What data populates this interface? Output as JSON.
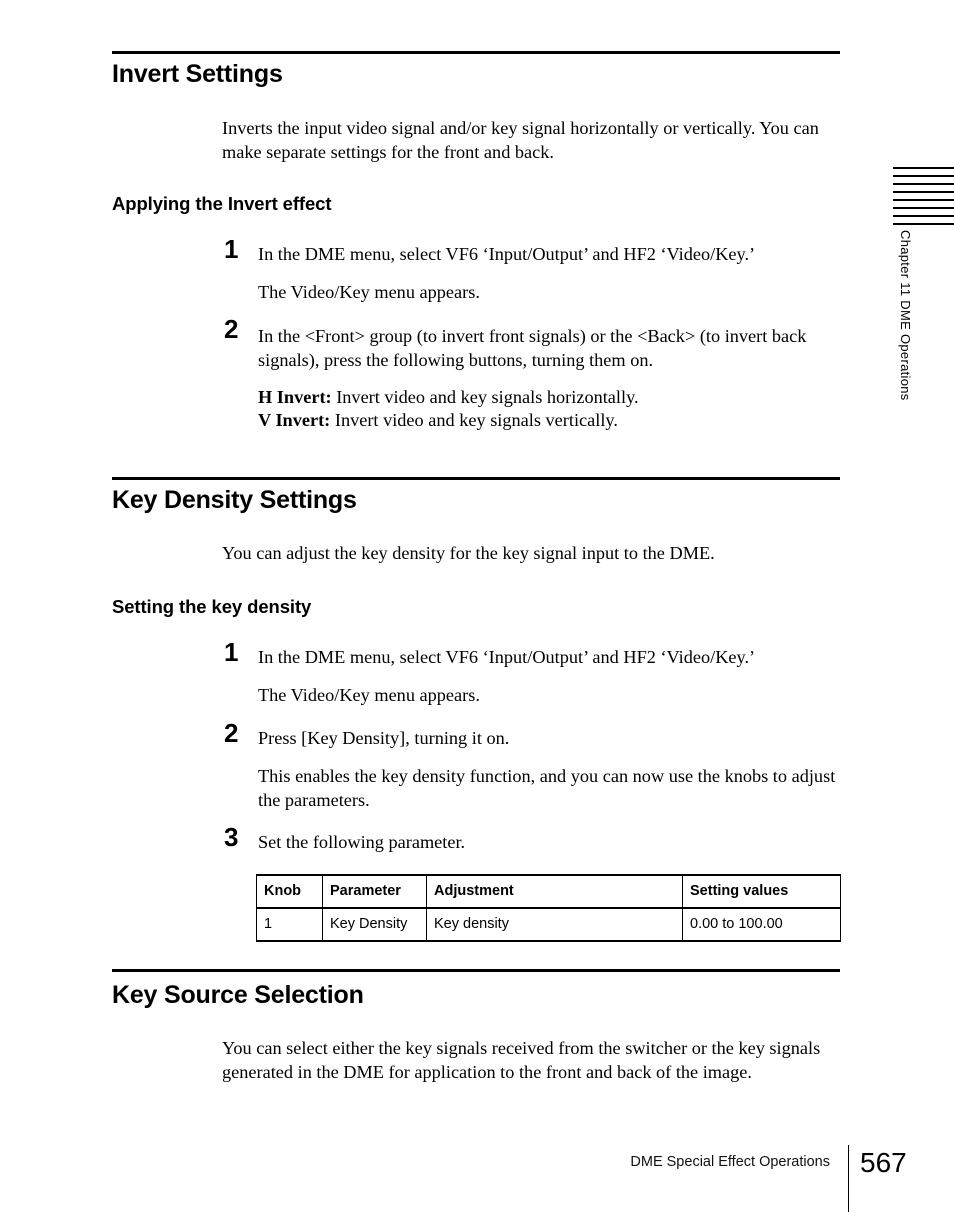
{
  "document": {
    "footer_text": "DME Special Effect Operations",
    "page_number": "567",
    "chapter_tab": "Chapter 11   DME Operations"
  },
  "sections": [
    {
      "title": "Invert Settings",
      "intro": "Inverts the input video signal and/or key signal horizontally or vertically. You can make separate settings for the front and back.",
      "subheading": "Applying the Invert effect",
      "steps": [
        {
          "number": "1",
          "text": "In the DME menu, select VF6 ‘Input/Output’ and HF2 ‘Video/Key.’",
          "result": "The Video/Key menu appears."
        },
        {
          "number": "2",
          "text": "In the <Front> group (to invert front signals) or the <Back> (to invert back signals), press the following buttons, turning them on.",
          "definitions": [
            {
              "term": "H Invert:",
              "desc": " Invert video and key signals horizontally."
            },
            {
              "term": "V Invert:",
              "desc": " Invert video and key signals vertically."
            }
          ]
        }
      ]
    },
    {
      "title": "Key Density Settings",
      "intro": "You can adjust the key density for the key signal input to the DME.",
      "subheading": "Setting the key density",
      "steps": [
        {
          "number": "1",
          "text": "In the DME menu, select VF6 ‘Input/Output’ and HF2 ‘Video/Key.’",
          "result": "The Video/Key menu appears."
        },
        {
          "number": "2",
          "text": "Press [Key Density], turning it on.",
          "result": "This enables the key density function, and you can now use the knobs to adjust the parameters."
        },
        {
          "number": "3",
          "text": "Set the following parameter."
        }
      ],
      "table": {
        "headers": [
          "Knob",
          "Parameter",
          "Adjustment",
          "Setting values"
        ],
        "rows": [
          [
            "1",
            "Key Density",
            "Key density",
            "0.00 to 100.00"
          ]
        ]
      }
    },
    {
      "title": "Key Source Selection",
      "intro": "You can select either the key signals received from the switcher or the key signals generated in the DME for application to the front and back of the image."
    }
  ]
}
